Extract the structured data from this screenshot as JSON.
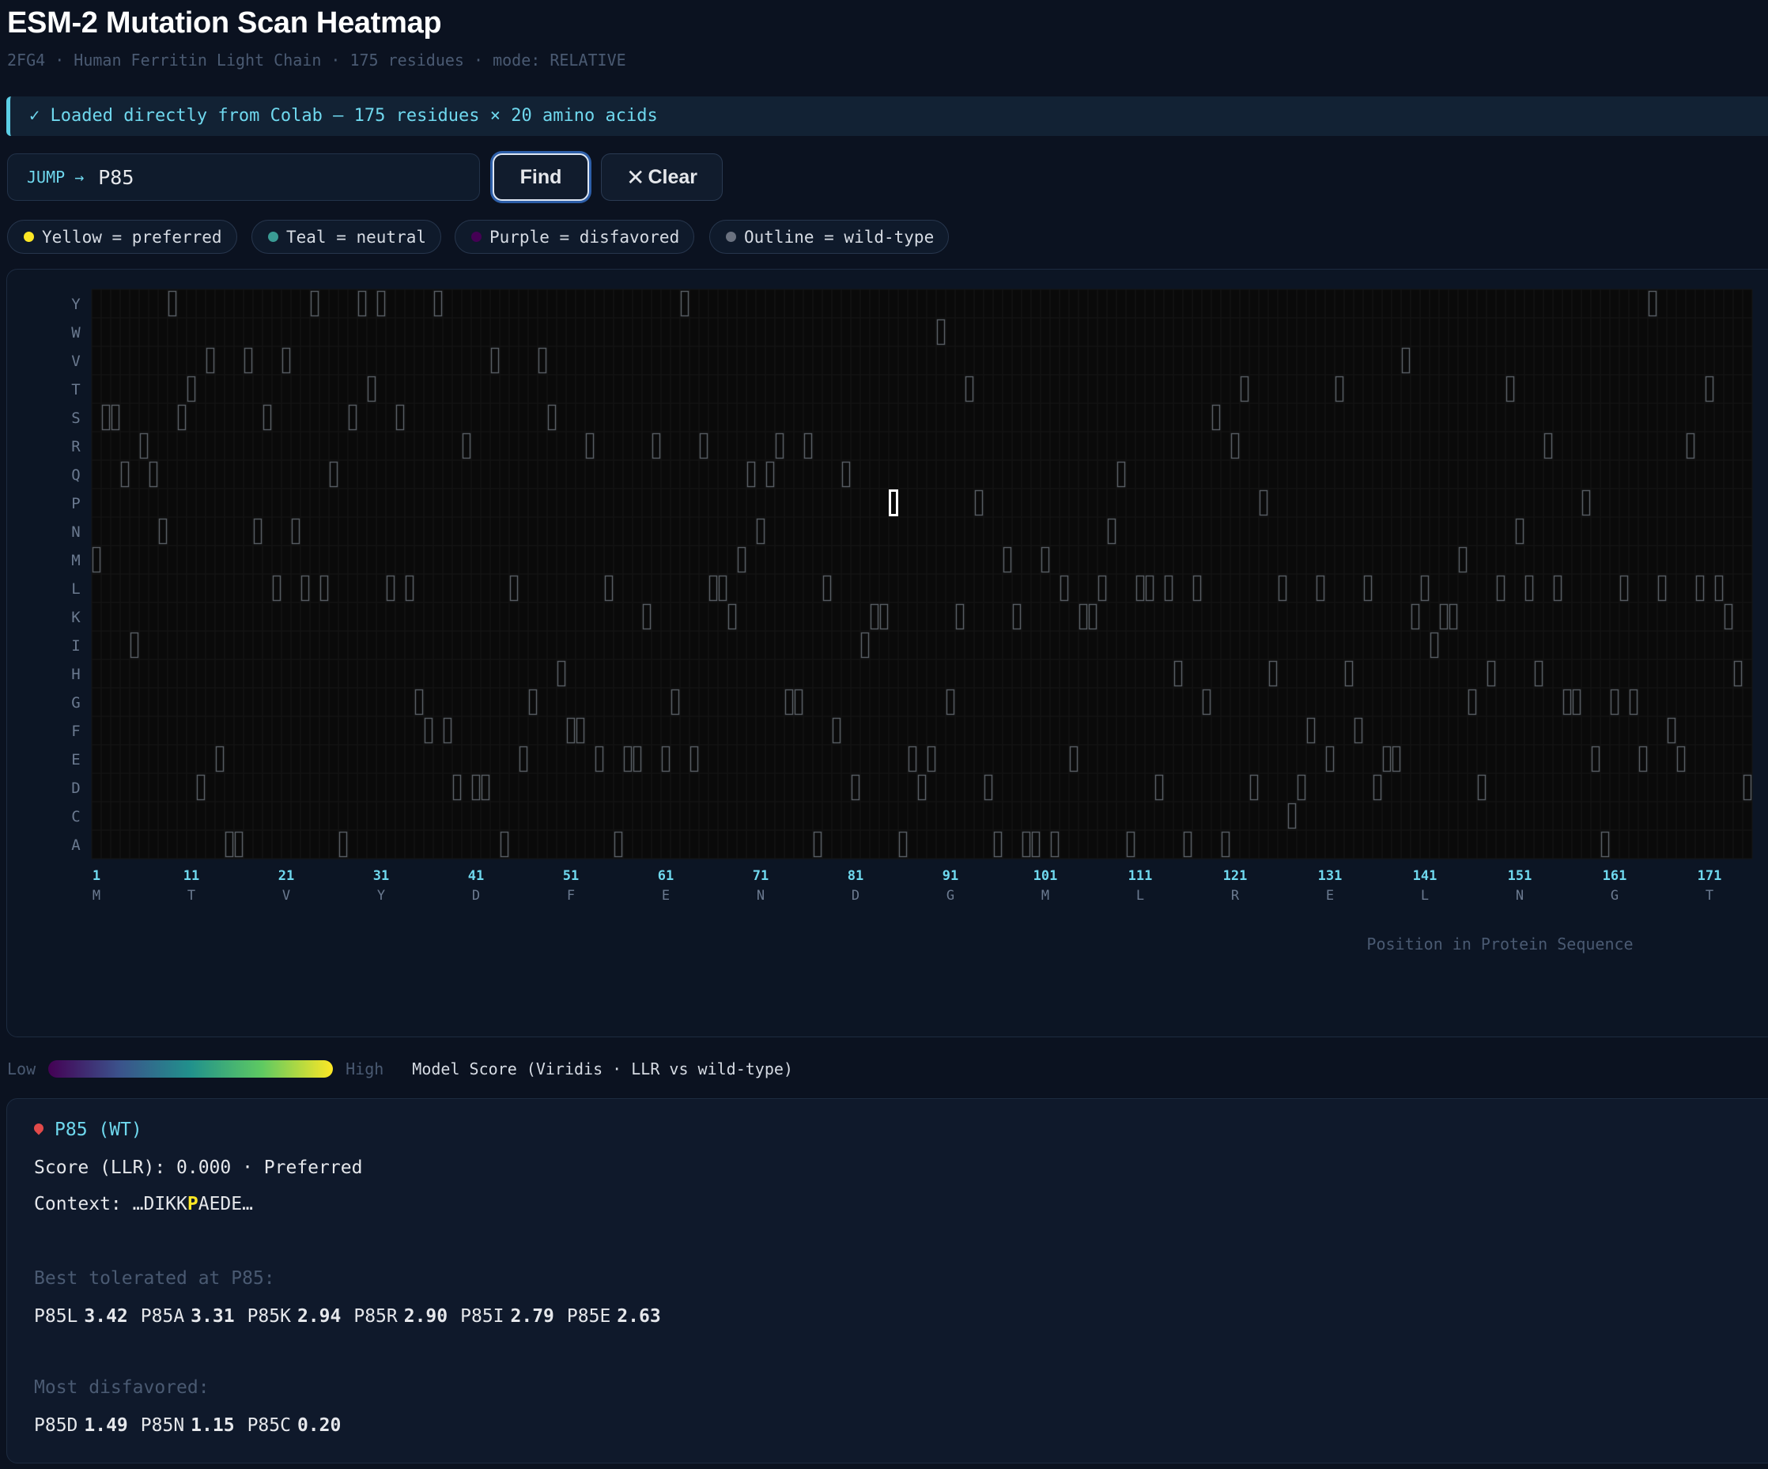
{
  "header": {
    "title": "ESM-2 Mutation Scan Heatmap",
    "subtitle": "2FG4 · Human Ferritin Light Chain · 175 residues · mode: RELATIVE"
  },
  "banner": {
    "text": "✓ Loaded directly from Colab — 175 residues × 20 amino acids"
  },
  "jump": {
    "label": "JUMP →",
    "value": "P85"
  },
  "buttons": {
    "find": "Find",
    "clear": "Clear"
  },
  "legend": [
    {
      "label": "Yellow = preferred",
      "color": "#fde725"
    },
    {
      "label": "Teal = neutral",
      "color": "#21918c"
    },
    {
      "label": "Purple = disfavored",
      "color": "#440154"
    },
    {
      "label": "Outline = wild-type",
      "color": "#6b7280"
    }
  ],
  "chart_data": {
    "type": "heatmap",
    "residue_count": 175,
    "y_amino_acids": [
      "Y",
      "W",
      "V",
      "T",
      "S",
      "R",
      "Q",
      "P",
      "N",
      "M",
      "L",
      "K",
      "I",
      "H",
      "G",
      "F",
      "E",
      "D",
      "C",
      "A"
    ],
    "x_ticks": [
      {
        "pos": 1,
        "aa": "M"
      },
      {
        "pos": 11,
        "aa": "T"
      },
      {
        "pos": 21,
        "aa": "V"
      },
      {
        "pos": 31,
        "aa": "Y"
      },
      {
        "pos": 41,
        "aa": "D"
      },
      {
        "pos": 51,
        "aa": "F"
      },
      {
        "pos": 61,
        "aa": "E"
      },
      {
        "pos": 71,
        "aa": "N"
      },
      {
        "pos": 81,
        "aa": "D"
      },
      {
        "pos": 91,
        "aa": "G"
      },
      {
        "pos": 101,
        "aa": "M"
      },
      {
        "pos": 111,
        "aa": "L"
      },
      {
        "pos": 121,
        "aa": "R"
      },
      {
        "pos": 131,
        "aa": "E"
      },
      {
        "pos": 141,
        "aa": "L"
      },
      {
        "pos": 151,
        "aa": "N"
      },
      {
        "pos": 161,
        "aa": "G"
      },
      {
        "pos": 171,
        "aa": "T"
      }
    ],
    "wild_type_sequence": "MSSQIRQNYSTDVEAAVNSLVNLYLQASYTYLSLGFYFDRDDVALEGVSHFFRELAEEKREGYERLLKMQNQRGGRALFQDIKKPAEDEWGKTPDAMKAAMALEKKLNQALLDLHALGSARTDPHLCDFLETHFLDEEVKLIKKMGDHLTNLHRLGGPEAGLGEYLFERLTLKHD",
    "selected_position": 85,
    "xlabel": "Position in Protein Sequence"
  },
  "colorbar": {
    "low": "Low",
    "high": "High",
    "title": "Model Score (Viridis · LLR vs wild-type)"
  },
  "detail": {
    "heading": "P85 (WT)",
    "score_line": "Score (LLR): 0.000 · Preferred",
    "context_prefix": "Context: …DIKK",
    "context_residue": "P",
    "context_suffix": "AEDE…",
    "best_label": "Best tolerated at P85:",
    "best": [
      {
        "mut": "P85L",
        "score": "3.42"
      },
      {
        "mut": "P85A",
        "score": "3.31"
      },
      {
        "mut": "P85K",
        "score": "2.94"
      },
      {
        "mut": "P85R",
        "score": "2.90"
      },
      {
        "mut": "P85I",
        "score": "2.79"
      },
      {
        "mut": "P85E",
        "score": "2.63"
      }
    ],
    "worst_label": "Most disfavored:",
    "worst": [
      {
        "mut": "P85D",
        "score": "1.49"
      },
      {
        "mut": "P85N",
        "score": "1.15"
      },
      {
        "mut": "P85C",
        "score": "0.20"
      }
    ]
  }
}
